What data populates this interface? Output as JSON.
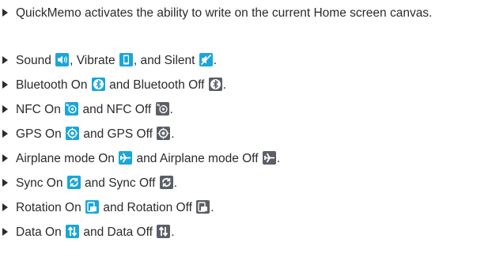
{
  "items": [
    {
      "text": "QuickMemo activates the ability to write on the current Home screen canvas."
    },
    {
      "parts": [
        "Sound ",
        ", Vibrate ",
        ", and Silent ",
        "."
      ],
      "icons": [
        "sound-icon",
        "vibrate-icon",
        "silent-icon"
      ]
    },
    {
      "parts": [
        "Bluetooth On ",
        " and Bluetooth Off ",
        "."
      ],
      "icons": [
        "bluetooth-on-icon",
        "bluetooth-off-icon"
      ]
    },
    {
      "parts": [
        "NFC On ",
        " and NFC Off ",
        "."
      ],
      "icons": [
        "nfc-on-icon",
        "nfc-off-icon"
      ]
    },
    {
      "parts": [
        "GPS On ",
        " and GPS Off ",
        "."
      ],
      "icons": [
        "gps-on-icon",
        "gps-off-icon"
      ]
    },
    {
      "parts": [
        "Airplane mode On ",
        " and Airplane mode Off ",
        "."
      ],
      "icons": [
        "airplane-on-icon",
        "airplane-off-icon"
      ]
    },
    {
      "parts": [
        "Sync On ",
        " and Sync Off ",
        "."
      ],
      "icons": [
        "sync-on-icon",
        "sync-off-icon"
      ]
    },
    {
      "parts": [
        "Rotation On ",
        " and Rotation Off ",
        "."
      ],
      "icons": [
        "rotation-on-icon",
        "rotation-off-icon"
      ]
    },
    {
      "parts": [
        "Data On ",
        " and Data Off ",
        "."
      ],
      "icons": [
        "data-on-icon",
        "data-off-icon"
      ]
    }
  ],
  "colors": {
    "icon_on": "#1aa6d8",
    "icon_off": "#5b5f66",
    "text": "#2b2b2b"
  }
}
